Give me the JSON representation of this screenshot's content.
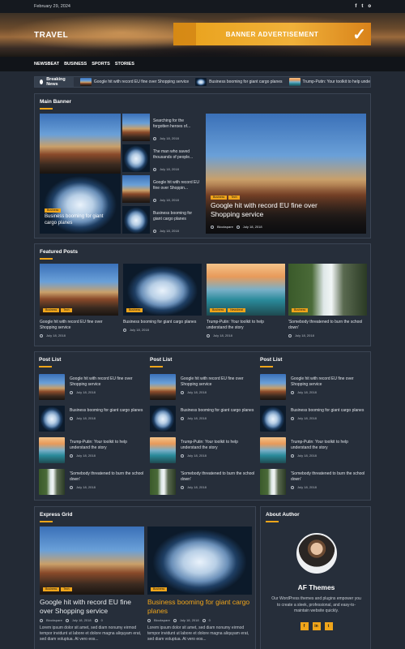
{
  "topbar": {
    "date": "February 29, 2024",
    "social": [
      "f",
      "t",
      "o"
    ]
  },
  "header": {
    "site_title": "TRAVEL",
    "ad_text": "BANNER ADVERTISEMENT"
  },
  "nav": {
    "items": [
      "NEWSBEAT",
      "BUSINESS",
      "SPORTS",
      "STORIES"
    ]
  },
  "breaking": {
    "label": "Breaking News",
    "items": [
      "Google hit with record EU fine over Shopping service",
      "Business booming for giant cargo planes",
      "Trump-Putin: Your toolkit to help unde"
    ]
  },
  "main_banner": {
    "title": "Main Banner",
    "left_big": {
      "title": "Business booming for giant cargo planes",
      "tag": "Business"
    },
    "small_items": [
      {
        "title": "Searching for the forgotten heroes of...",
        "date": "July 18, 2018"
      },
      {
        "title": "The man who saved thousands of people...",
        "date": "July 18, 2018"
      },
      {
        "title": "Google hit with record EU fine over Shoppin...",
        "date": "July 18, 2018"
      },
      {
        "title": "Business booming for giant cargo planes",
        "date": "July 18, 2018"
      }
    ],
    "feature": {
      "title": "Google hit with record EU fine over Shopping service",
      "tags": [
        "Business",
        "Tech"
      ],
      "author": "Blockspare",
      "date": "July 18, 2018"
    }
  },
  "featured": {
    "title": "Featured Posts",
    "items": [
      {
        "title": "Google hit with record EU fine over Shopping service",
        "date": "July 18, 2018",
        "tags": [
          "Business",
          "Tech"
        ]
      },
      {
        "title": "Business booming for giant cargo planes",
        "date": "July 18, 2018",
        "tags": [
          "Business"
        ]
      },
      {
        "title": "Trump-Putin: Your toolkit to help understand the story",
        "date": "July 18, 2018",
        "tags": [
          "Business",
          "Newsbeat"
        ]
      },
      {
        "title": "'Somebody threatened to burn the school down'",
        "date": "July 18, 2018",
        "tags": [
          "Business"
        ]
      }
    ]
  },
  "post_lists": {
    "title": "Post List",
    "items": [
      {
        "title": "Google hit with record EU fine over Shopping service",
        "date": "July 18, 2018"
      },
      {
        "title": "Business booming for giant cargo planes",
        "date": "July 18, 2018"
      },
      {
        "title": "Trump-Putin: Your toolkit to help understand the story",
        "date": "July 18, 2018"
      },
      {
        "title": "'Somebody threatened to burn the school down'",
        "date": "July 18, 2018"
      }
    ]
  },
  "express": {
    "title": "Express Grid",
    "items": [
      {
        "title": "Google hit with record EU fine over Shopping service",
        "tags": [
          "Business",
          "Tech"
        ],
        "author": "Blockspare",
        "date": "July 18, 2018",
        "comments": "0",
        "excerpt": "Lorem ipsum dolor sit amet, sed diam nonumy eirmod tempor invidunt ut labore et dolore magna aliquyam erat, sed diam voluptua. At vero eos..."
      },
      {
        "title": "Business booming for giant cargo planes",
        "tags": [
          "Business"
        ],
        "author": "Blockspare",
        "date": "July 18, 2018",
        "comments": "0",
        "excerpt": "Lorem ipsum dolor sit amet, sed diam nonumy eirmod tempor invidunt ut labore et dolore magna aliquyam erat, sed diam voluptua. At vero eos..."
      }
    ]
  },
  "about": {
    "title": "About Author",
    "name": "AF Themes",
    "description": "Our WordPress themes and plugins empower you to create a sleek, professional, and easy-to-maintain website quickly.",
    "social": [
      "f",
      "in",
      "t"
    ]
  },
  "colors": {
    "accent": "#f0a51a",
    "background": "#232a35",
    "panel": "#262e3a"
  }
}
